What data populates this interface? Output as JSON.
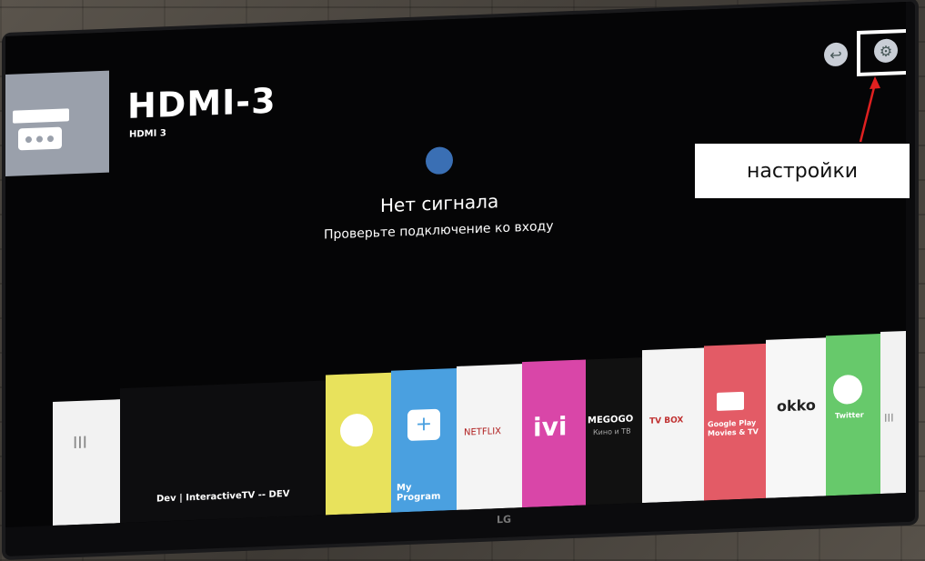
{
  "input": {
    "title": "HDMI-3",
    "subtitle": "HDMI 3"
  },
  "status": {
    "message": "Нет сигнала",
    "hint": "Проверьте подключение ко входу"
  },
  "top_icons": [
    "back-icon",
    "gear-icon"
  ],
  "annotation": {
    "label": "настройки",
    "color": "#e02020"
  },
  "apps": {
    "left_panel_label": "Dev | InteractiveTV -- DEV",
    "left_tile_symbol": "III",
    "tiles": [
      {
        "label": "",
        "color": "#e7e05a"
      },
      {
        "label": "My Program",
        "color": "#4aa0e0"
      },
      {
        "label": "NETFLIX",
        "color": "#ffffff"
      },
      {
        "label": "ivi",
        "color": "#d946a8"
      },
      {
        "label": "MEGOGO",
        "sub": "Кино и ТВ",
        "color": "#111111"
      },
      {
        "label": "TV BOX",
        "color": "#ffffff"
      },
      {
        "label": "Google Play Movies & TV",
        "color": "#e35b66"
      },
      {
        "label": "okko",
        "color": "#ffffff"
      },
      {
        "label": "Twitter",
        "color": "#67c96b"
      },
      {
        "label": "III",
        "color": "#ffffff"
      }
    ]
  },
  "brand": "LG"
}
